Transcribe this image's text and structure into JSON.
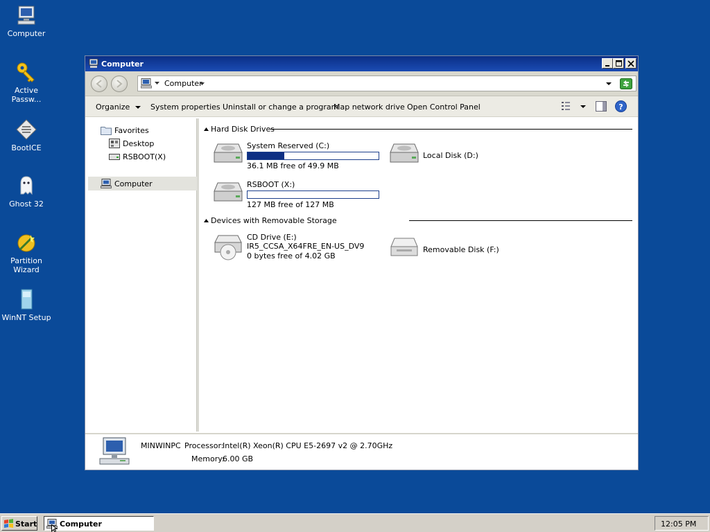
{
  "desktop": {
    "icons": [
      {
        "label": "Computer"
      },
      {
        "label": "Active Passw..."
      },
      {
        "label": "BootICE"
      },
      {
        "label": "Ghost 32"
      },
      {
        "label": "Partition Wizard"
      },
      {
        "label": "WinNT Setup"
      }
    ]
  },
  "window": {
    "title": "Computer",
    "address": {
      "path": "Computer"
    },
    "toolbar": {
      "organize": "Organize",
      "system_properties": "System properties",
      "uninstall": "Uninstall or change a program",
      "map_drive": "Map network drive",
      "control_panel": "Open Control Panel"
    },
    "nav": {
      "favorites": "Favorites",
      "desktop": "Desktop",
      "rsboot": "RSBOOT(X)",
      "computer": "Computer"
    },
    "groups": {
      "hdd": "Hard Disk Drives",
      "removable": "Devices with Removable Storage"
    },
    "drives": {
      "c": {
        "name": "System Reserved (C:)",
        "free": "36.1 MB free of 49.9 MB",
        "used_fraction": 0.28
      },
      "d": {
        "name": "Local Disk (D:)"
      },
      "x": {
        "name": "RSBOOT (X:)",
        "free": "127 MB free of 127 MB",
        "used_fraction": 0.0
      },
      "e": {
        "name": "CD Drive (E:)",
        "label": "IR5_CCSA_X64FRE_EN-US_DV9",
        "free": "0 bytes free of 4.02 GB"
      },
      "f": {
        "name": "Removable Disk (F:)"
      }
    },
    "details": {
      "computer_name": "MINWINPC",
      "processor_label": "Processor:",
      "processor_value": "Intel(R) Xeon(R) CPU E5-2697 v2 @ 2.70GHz",
      "memory_label": "Memory:",
      "memory_value": "6.00 GB"
    }
  },
  "taskbar": {
    "start": "Start",
    "task": "Computer",
    "clock": "12:05 PM"
  }
}
